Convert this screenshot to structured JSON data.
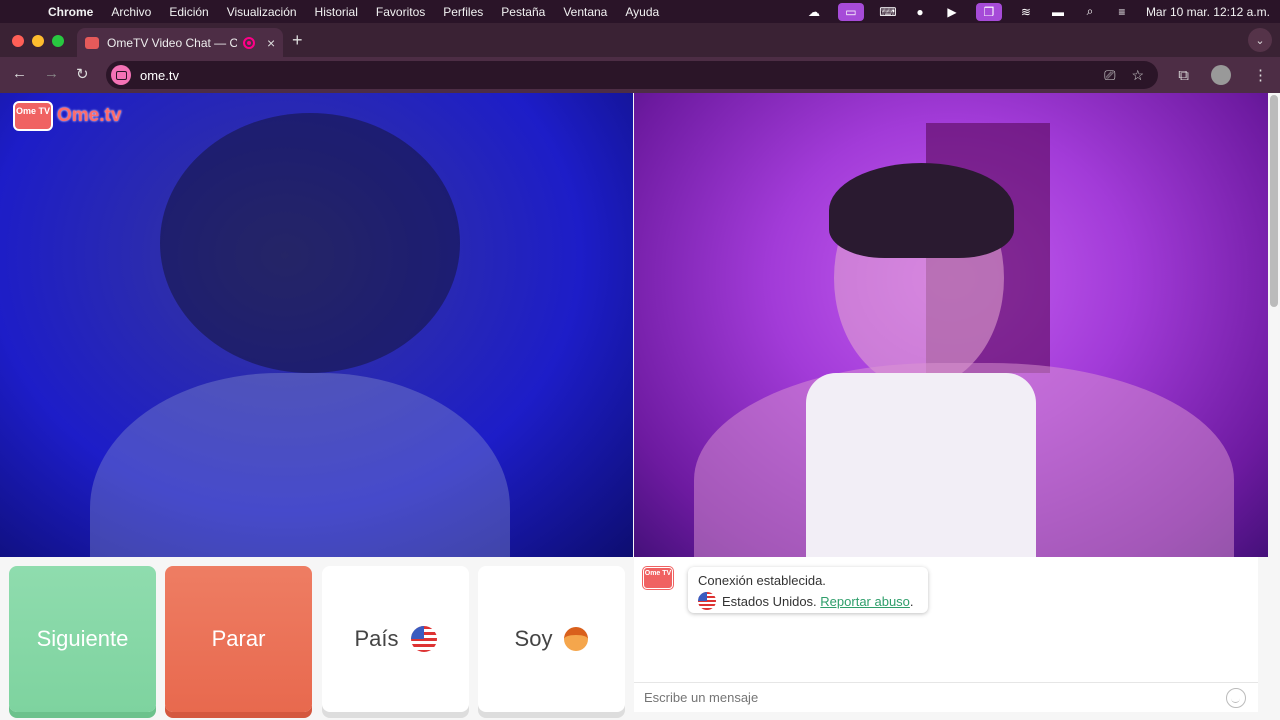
{
  "menubar": {
    "app_name": "Chrome",
    "items": [
      "Archivo",
      "Edición",
      "Visualización",
      "Historial",
      "Favoritos",
      "Perfiles",
      "Pestaña",
      "Ventana",
      "Ayuda"
    ],
    "clock": "Mar 10 mar.  12:12 a.m."
  },
  "browser": {
    "tab_title": "OmeTV Video Chat — Om",
    "url": "ome.tv"
  },
  "site": {
    "logo_badge": "Ome TV",
    "logo_text": "Ome.tv"
  },
  "buttons": {
    "next": "Siguiente",
    "stop": "Parar",
    "country": "País",
    "gender": "Soy"
  },
  "chat": {
    "logo_badge": "Ome TV",
    "status": "Conexión establecida.",
    "country": "Estados Unidos.",
    "report_link": "Reportar abuso",
    "report_suffix": ".",
    "input_placeholder": "Escribe un mensaje"
  },
  "colors": {
    "next": "#7ed39f",
    "stop": "#e8694e",
    "link": "#2e9e6a",
    "brand": "#f06262"
  }
}
